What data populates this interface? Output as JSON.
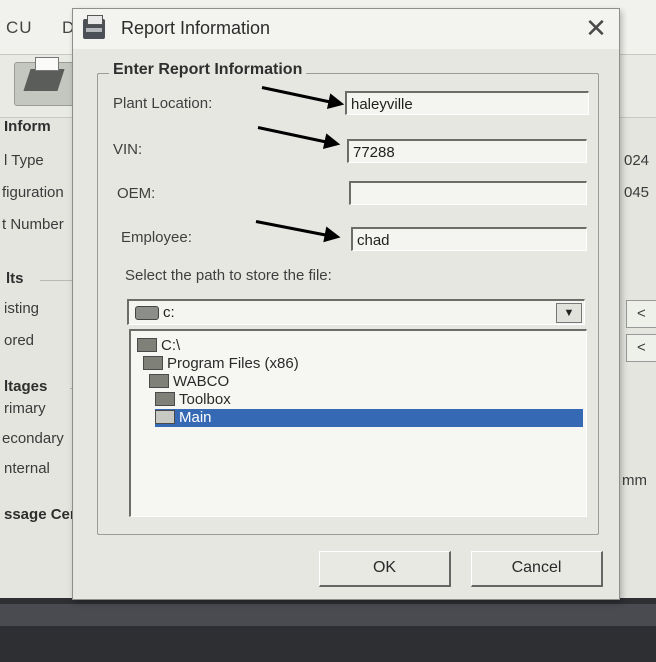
{
  "background_app": {
    "menu": [
      "CU",
      "D"
    ],
    "left_labels": {
      "section_info": "Inform",
      "type": "l Type",
      "configuration": "figuration",
      "number": "t Number",
      "results": "lts",
      "testing": "isting",
      "stored": "ored",
      "voltages": "ltages",
      "primary": "rimary",
      "secondary": "econdary",
      "internal": "nternal",
      "message_center": "ssage Cen"
    },
    "right_values": {
      "value1": "024",
      "value2": "045",
      "btn1": "<",
      "btn2": "<",
      "unit": "mm"
    }
  },
  "dialog": {
    "title": "Report Information",
    "close_glyph": "✕",
    "group_title": "Enter Report Information",
    "fields": {
      "plant_location": {
        "label": "Plant Location:",
        "value": "haleyville"
      },
      "vin": {
        "label": "VIN:",
        "value": "77288"
      },
      "oem": {
        "label": "OEM:",
        "value": ""
      },
      "employee": {
        "label": "Employee:",
        "value": "chad"
      }
    },
    "path_prompt": "Select the path to store the file:",
    "drive": {
      "selected": "c:",
      "dropdown_glyph": "▼"
    },
    "directories": [
      "C:\\",
      "Program Files (x86)",
      "WABCO",
      "Toolbox",
      "Main"
    ],
    "selected_directory": "Main",
    "buttons": {
      "ok": "OK",
      "cancel": "Cancel"
    }
  },
  "annotations": {
    "arrow_color": "#000000"
  },
  "colors": {
    "selection": "#3569b3"
  }
}
